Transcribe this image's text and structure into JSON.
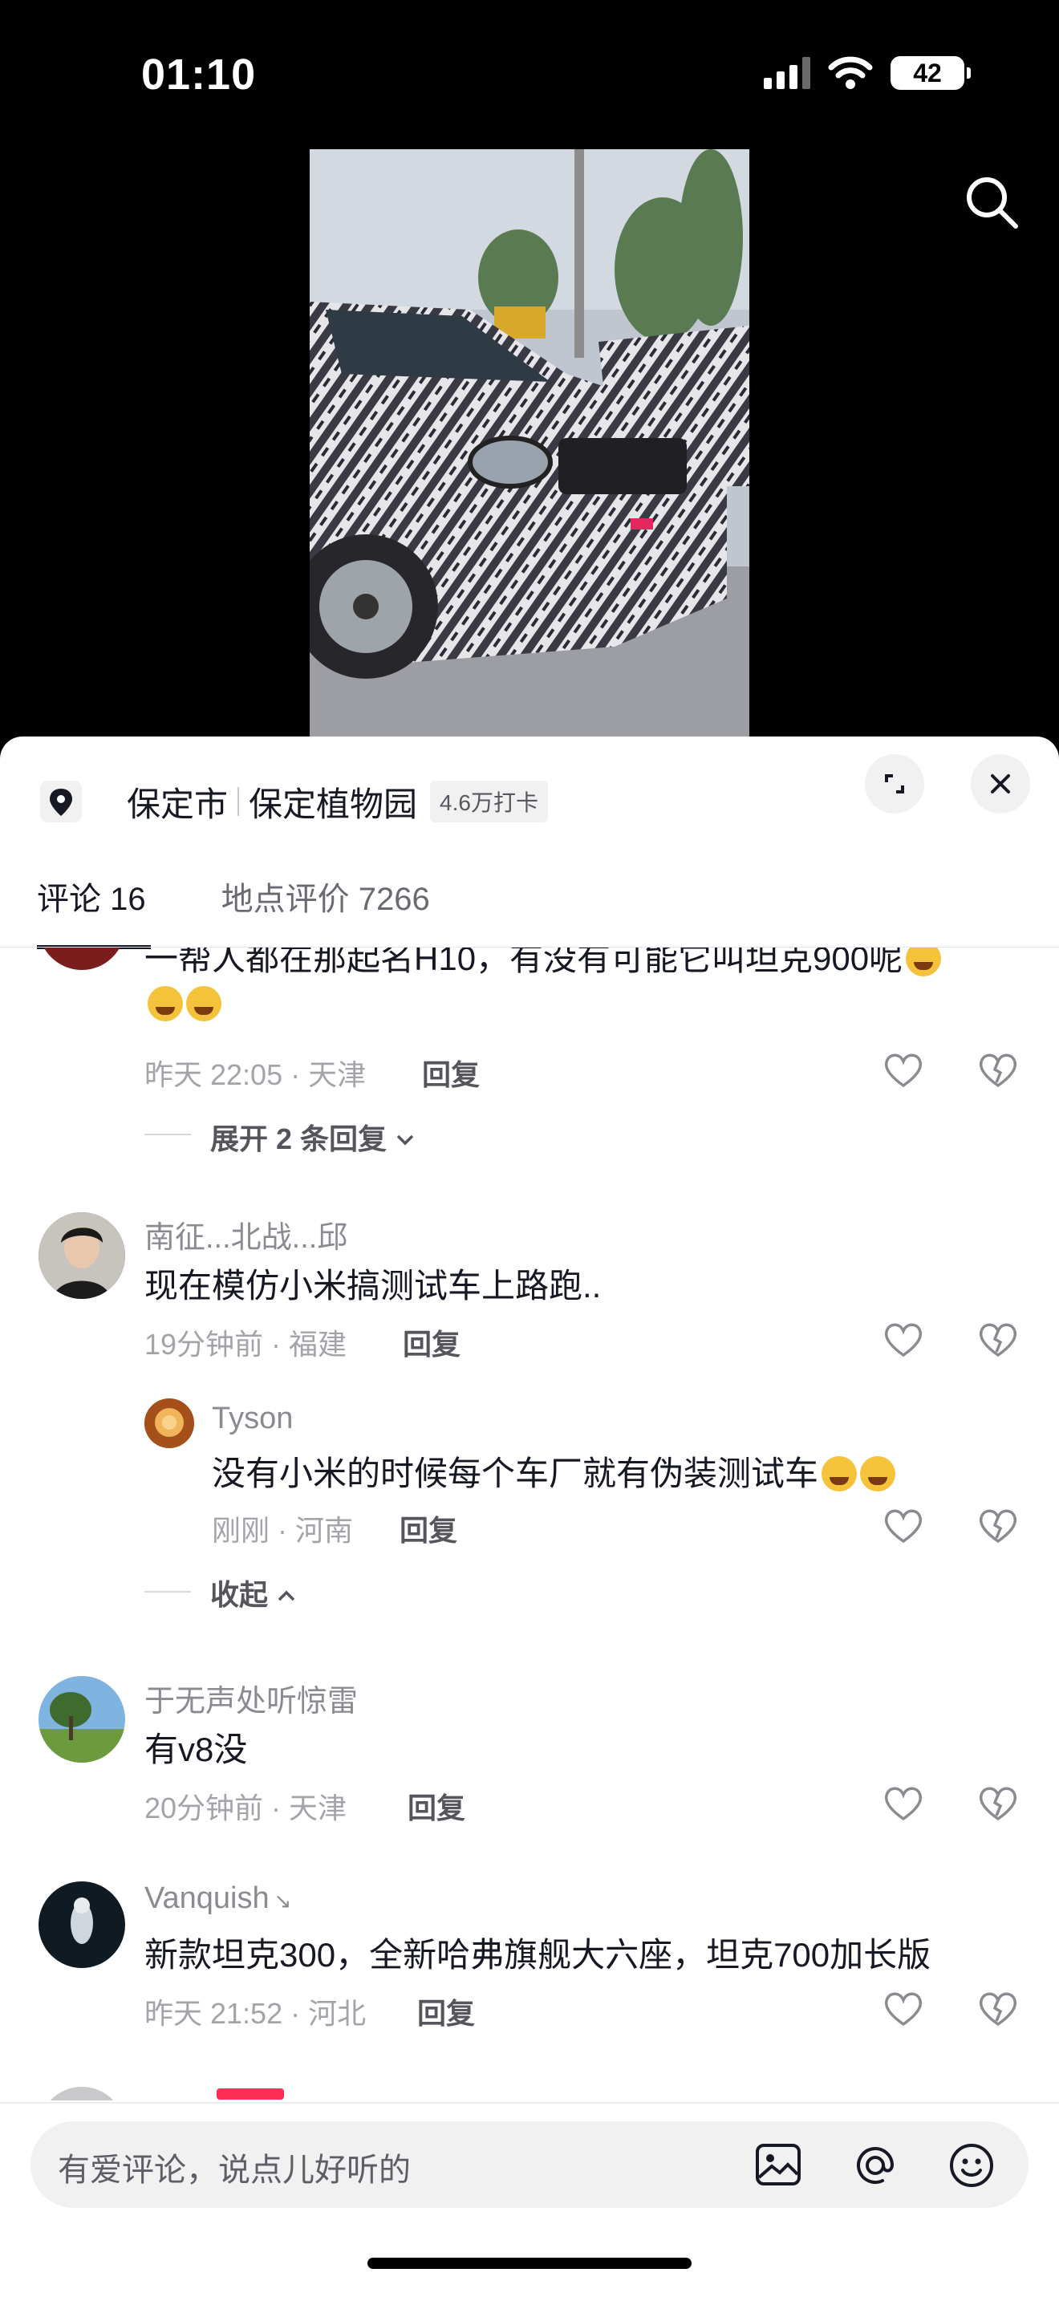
{
  "status_bar": {
    "time": "01:10",
    "battery": "42"
  },
  "location": {
    "city": "保定市",
    "place": "保定植物园",
    "checkins": "4.6万打卡"
  },
  "tabs": [
    {
      "label": "评论 16"
    },
    {
      "label": "地点评价 7266"
    }
  ],
  "comments": [
    {
      "text_line1": "一帮人都在那起名H10，有没有可能它叫坦克900呢",
      "meta": "昨天 22:05 · 天津",
      "reply": "回复",
      "expand": "展开 2 条回复"
    },
    {
      "name": "南征...北战...邱",
      "text": "现在模仿小米搞测试车上路跑..",
      "meta": "19分钟前 · 福建",
      "reply": "回复",
      "sub": {
        "name": "Tyson",
        "text": "没有小米的时候每个车厂就有伪装测试车",
        "meta": "刚刚 · 河南",
        "reply": "回复"
      },
      "collapse": "收起"
    },
    {
      "name": "于无声处听惊雷",
      "text": "有v8没",
      "meta": "20分钟前 · 天津",
      "reply": "回复"
    },
    {
      "name": "Vanquish",
      "text": "新款坦克300，全新哈弗旗舰大六座，坦克700加长版",
      "meta": "昨天 21:52 · 河北",
      "reply": "回复"
    }
  ],
  "input": {
    "placeholder": "有爱评论，说点儿好听的"
  },
  "icons": {
    "search": "search-icon",
    "pin": "location-pin-icon",
    "expand": "fullscreen-icon",
    "close": "close-icon",
    "like": "heart-icon",
    "dislike": "broken-heart-icon",
    "image": "image-icon",
    "mention": "at-icon",
    "emoji": "emoji-icon"
  }
}
